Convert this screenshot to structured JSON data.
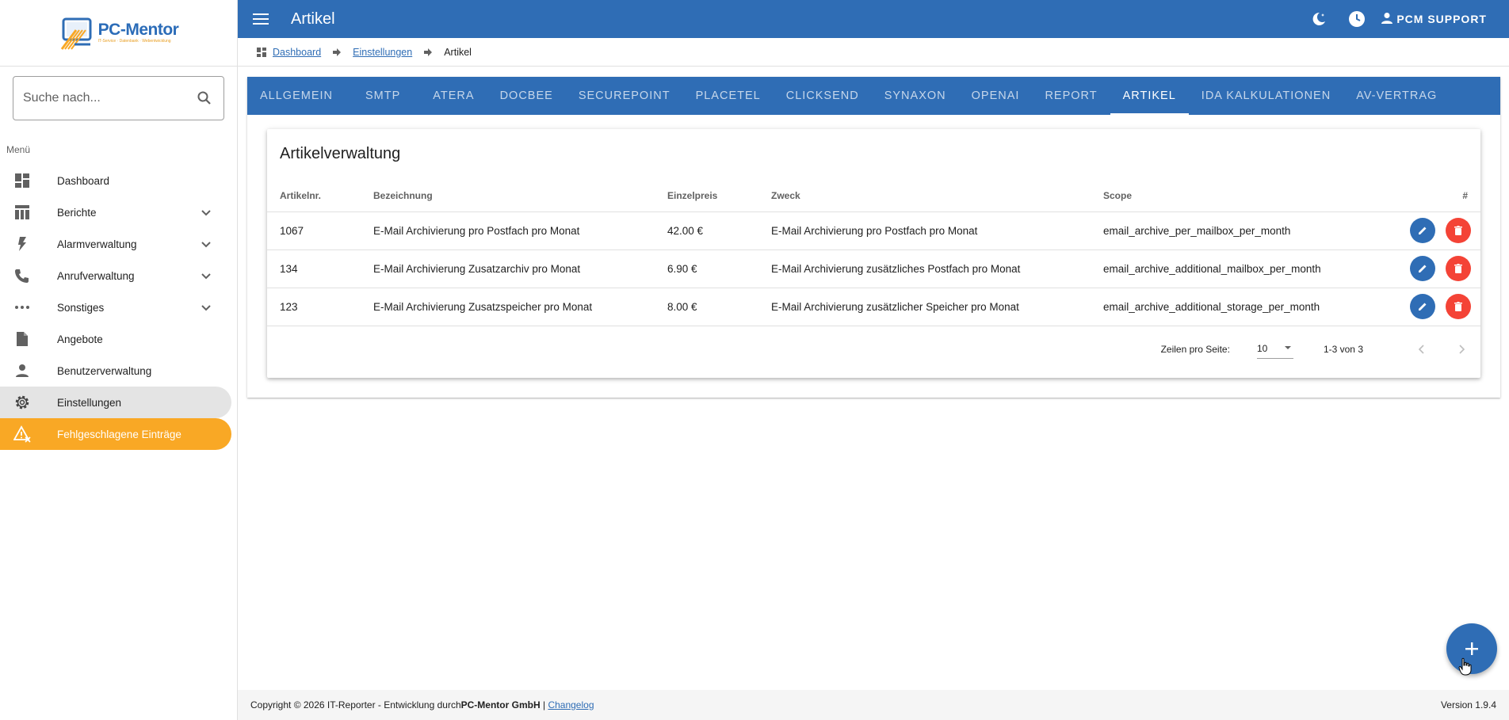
{
  "app": {
    "logo_name": "PC-Mentor",
    "logo_sub": "IT-Service · Datenbank · Webentwicklung",
    "brand_color": "#2f6db5",
    "warn_color": "#f9a825",
    "danger_color": "#f44336"
  },
  "topbar": {
    "title": "Artikel",
    "user_label": "PCM SUPPORT",
    "icons": [
      "menu-icon",
      "theme-moon-icon",
      "clock-icon",
      "account-icon"
    ]
  },
  "breadcrumb": {
    "items": [
      "Dashboard",
      "Einstellungen",
      "Artikel"
    ]
  },
  "sidebar": {
    "search_placeholder": "Suche nach...",
    "menu_heading": "Menü",
    "items": [
      {
        "label": "Dashboard",
        "icon": "dashboard-icon"
      },
      {
        "label": "Berichte",
        "icon": "reports-icon",
        "expandable": true
      },
      {
        "label": "Alarmverwaltung",
        "icon": "lightning-icon",
        "expandable": true
      },
      {
        "label": "Anrufverwaltung",
        "icon": "phone-icon",
        "expandable": true
      },
      {
        "label": "Sonstiges",
        "icon": "dots-icon",
        "expandable": true
      },
      {
        "label": "Angebote",
        "icon": "document-icon"
      },
      {
        "label": "Benutzerverwaltung",
        "icon": "user-icon"
      },
      {
        "label": "Einstellungen",
        "icon": "gear-icon",
        "active": true
      },
      {
        "label": "Fehlgeschlagene Einträge",
        "icon": "warning-icon",
        "highlight": true
      }
    ]
  },
  "tabs": {
    "items": [
      "Allgemein",
      "SMTP",
      "Atera",
      "DocBee",
      "Securepoint",
      "Placetel",
      "ClickSend",
      "Synaxon",
      "OpenAI",
      "Report",
      "Artikel",
      "IDA Kalkulationen",
      "AV-Vertrag"
    ],
    "active": "Artikel"
  },
  "card": {
    "title": "Artikelverwaltung",
    "columns": [
      "Artikelnr.",
      "Bezeichnung",
      "Einzelpreis",
      "Zweck",
      "Scope",
      "#"
    ],
    "rows": [
      [
        "1067",
        "E-Mail Archivierung pro Postfach pro Monat",
        "42.00 €",
        "E-Mail Archivierung pro Postfach pro Monat",
        "email_archive_per_mailbox_per_month"
      ],
      [
        "134",
        "E-Mail Archivierung Zusatzarchiv pro Monat",
        "6.90 €",
        "E-Mail Archivierung zusätzliches Postfach pro Monat",
        "email_archive_additional_mailbox_per_month"
      ],
      [
        "123",
        "E-Mail Archivierung Zusatzspeicher pro Monat",
        "8.00 €",
        "E-Mail Archivierung zusätzlicher Speicher pro Monat",
        "email_archive_additional_storage_per_month"
      ]
    ],
    "pager": {
      "rows_label": "Zeilen pro Seite:",
      "rows_value": "10",
      "range": "1-3 von 3"
    }
  },
  "footer": {
    "prefix": "Copyright © 2026 IT-Reporter - Entwicklung durch ",
    "company": "PC-Mentor GmbH",
    "sep": " | ",
    "changelog": "Changelog",
    "version": "Version 1.9.4"
  }
}
